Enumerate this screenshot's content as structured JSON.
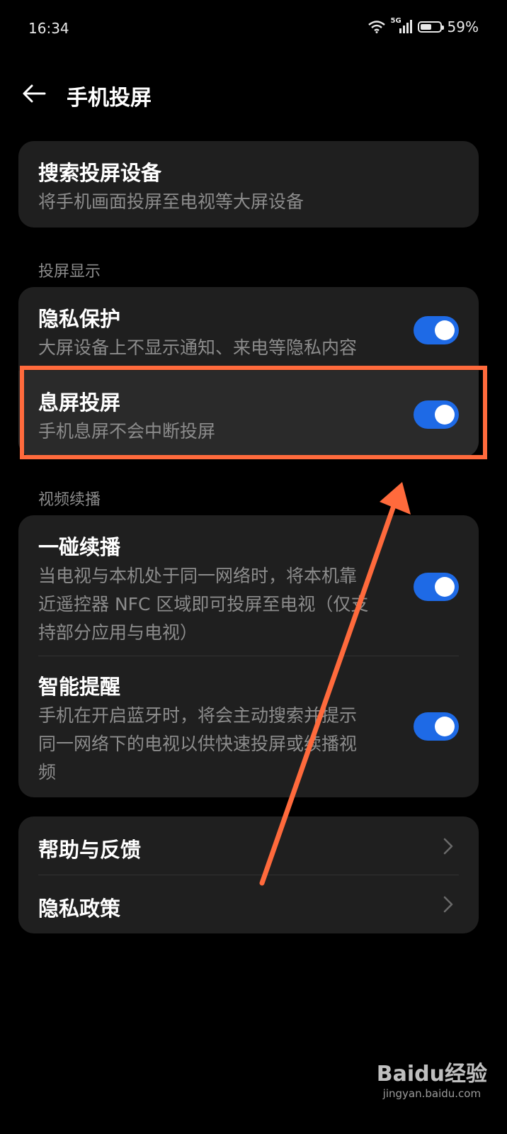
{
  "status": {
    "time": "16:34",
    "network": "5G",
    "battery": "59%",
    "battery_level": 0.59
  },
  "header": {
    "title": "手机投屏"
  },
  "search": {
    "title": "搜索投屏设备",
    "subtitle": "将手机画面投屏至电视等大屏设备"
  },
  "display_section": {
    "label": "投屏显示",
    "items": [
      {
        "title": "隐私保护",
        "subtitle": "大屏设备上不显示通知、来电等隐私内容",
        "enabled": true
      },
      {
        "title": "息屏投屏",
        "subtitle": "手机息屏不会中断投屏",
        "enabled": true
      }
    ]
  },
  "video_section": {
    "label": "视频续播",
    "items": [
      {
        "title": "一碰续播",
        "subtitle_lines": [
          "当电视与本机处于同一网络时，将本机靠",
          "近遥控器 NFC 区域即可投屏至电视（仅支",
          "持部分应用与电视）"
        ],
        "enabled": true
      },
      {
        "title": "智能提醒",
        "subtitle_lines": [
          "手机在开启蓝牙时，将会主动搜索并提示",
          "同一网络下的电视以供快速投屏或续播视",
          "频"
        ],
        "enabled": true
      }
    ]
  },
  "links": [
    {
      "label": "帮助与反馈"
    },
    {
      "label": "隐私政策"
    }
  ],
  "annotation": {
    "color": "#ff6a3c"
  },
  "watermark": {
    "logo": "Baidu经验",
    "url": "jingyan.baidu.com"
  },
  "colors": {
    "accent": "#1e6ae6",
    "card": "#1f1f1f",
    "background": "#000000"
  }
}
